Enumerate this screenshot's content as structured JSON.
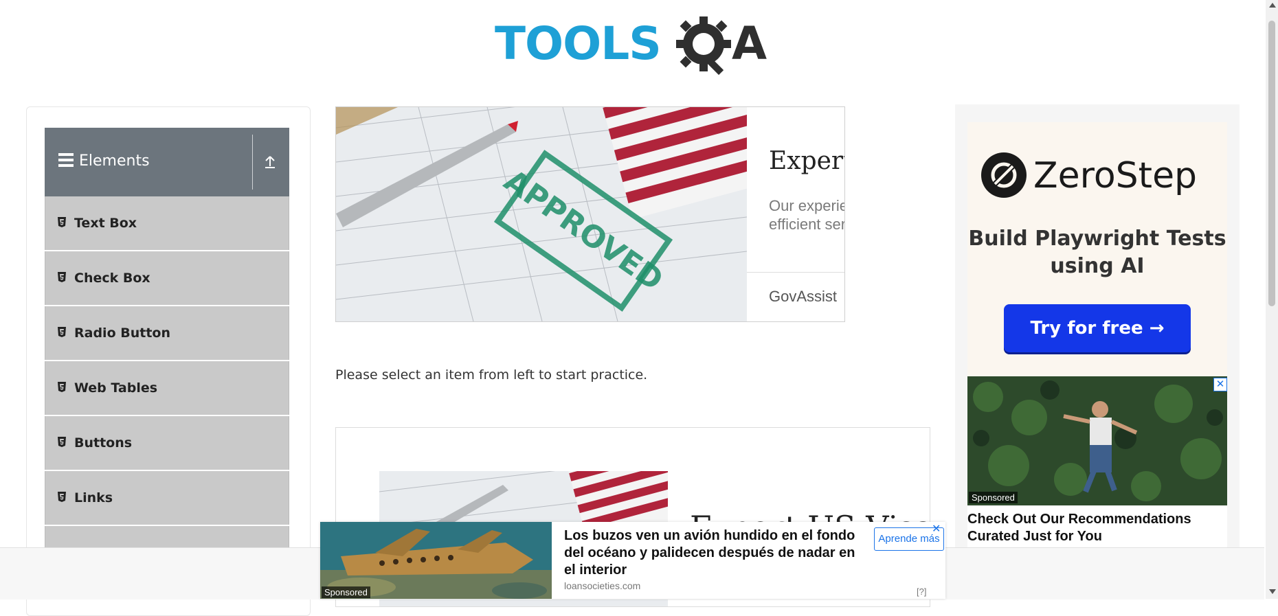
{
  "header": {
    "logo_text_left": "TOOLS",
    "logo_text_right": "A",
    "logo_icon": "gear-magnifier-icon"
  },
  "sidebar": {
    "group_title": "Elements",
    "items": [
      {
        "label": "Text Box",
        "icon": "html5-icon"
      },
      {
        "label": "Check Box",
        "icon": "html5-icon"
      },
      {
        "label": "Radio Button",
        "icon": "html5-icon"
      },
      {
        "label": "Web Tables",
        "icon": "html5-icon"
      },
      {
        "label": "Buttons",
        "icon": "html5-icon"
      },
      {
        "label": "Links",
        "icon": "html5-icon"
      }
    ]
  },
  "top_ad": {
    "headline": "Expert US Visa A",
    "description": "Our experienced team offe and efficient service.",
    "brand": "GovAssist"
  },
  "main": {
    "practice_text": "Please select an item from left to start practice."
  },
  "lower_ad": {
    "headline": "Expert US Visa Ass"
  },
  "side_ad": {
    "brand": "ZeroStep",
    "tagline": "Build Playwright Tests using AI",
    "cta": "Try for free →"
  },
  "rec_ad": {
    "sponsored": "Sponsored",
    "title": "Check Out Our Recommendations Curated Just for You",
    "close": "✕"
  },
  "bottom_ad": {
    "sponsored": "Sponsored",
    "title": "Los buzos ven un avión hundido en el fondo del océano y palidecen después de nadar en el interior",
    "domain": "loansocieties.com",
    "cta": "Aprende más",
    "info": "[?]"
  },
  "colors": {
    "brand_blue": "#1ea0d6",
    "group_header": "#6c757d",
    "menu_item_bg": "#c9c9c9",
    "cta_blue": "#1437e8"
  }
}
